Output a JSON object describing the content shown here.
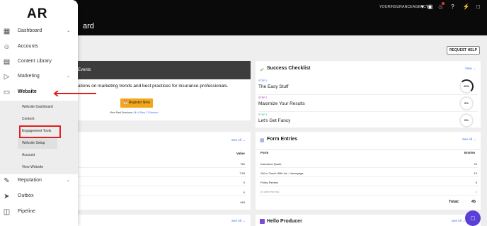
{
  "header": {
    "title": "ard",
    "agency": "YOURINSURANCEAGENCY",
    "icons": [
      "chevron-down-icon",
      "screen-icon",
      "bell-icon",
      "help-icon",
      "bolt-icon",
      "chat-icon"
    ]
  },
  "request_help": "REQUEST HELP",
  "events": {
    "title": "Events",
    "text": "ations on marketing trends and best practices for insurance professionals.",
    "button": "Register Now",
    "past_prefix": "View Past Sessions:",
    "past_link1": "All Hi Step",
    "past_link2": "CI Session"
  },
  "checklist": {
    "title": "Success Checklist",
    "view": "View →",
    "steps": [
      {
        "tag": "STEP 1",
        "name": "The Easy Stuff",
        "progress": "20%",
        "color": "#3a6ff0"
      },
      {
        "tag": "STEP 2",
        "name": "Maximize Your Results",
        "progress": "0%",
        "color": "#9c27b0"
      },
      {
        "tag": "STEP 3",
        "name": "Let's Get Fancy",
        "progress": "0%",
        "color": "#2bb673"
      }
    ]
  },
  "left_table": {
    "see_all": "See All →",
    "col_value": "Value",
    "values": [
      "760",
      "7.59",
      "0",
      "0",
      "463"
    ]
  },
  "form_entries": {
    "title": "Form Entries",
    "see_all": "See All →",
    "col_form": "Form",
    "col_entries": "Entries",
    "rows": [
      {
        "form": "Insurance Quote",
        "entries": "24"
      },
      {
        "form": "Get in Touch With Us - Homepage",
        "entries": "13"
      },
      {
        "form": "Policy Review",
        "entries": "6"
      },
      {
        "form": "(8 other forms)",
        "entries": "2"
      }
    ],
    "total_label": "Total:",
    "total_value": "45"
  },
  "bottom": {
    "see_all_left": "See All →",
    "hello_title": "Hello Producer",
    "see_all_right": "See All →"
  },
  "sidebar": {
    "logo": "AR",
    "items": [
      {
        "label": "Dashboard",
        "icon": "grid-icon"
      },
      {
        "label": "Accounts",
        "icon": "users-icon"
      },
      {
        "label": "Content Library",
        "icon": "library-icon"
      },
      {
        "label": "Marketing",
        "icon": "play-icon"
      },
      {
        "label": "Website",
        "icon": "monitor-icon"
      },
      {
        "label": "Reputation",
        "icon": "chart-icon"
      },
      {
        "label": "Outbox",
        "icon": "send-icon"
      },
      {
        "label": "Pipeline",
        "icon": "board-icon"
      }
    ],
    "website_sub": [
      "Website Dashboard",
      "Content",
      "Engagement Tools",
      "Website Setup",
      "Account",
      "View Website"
    ]
  }
}
